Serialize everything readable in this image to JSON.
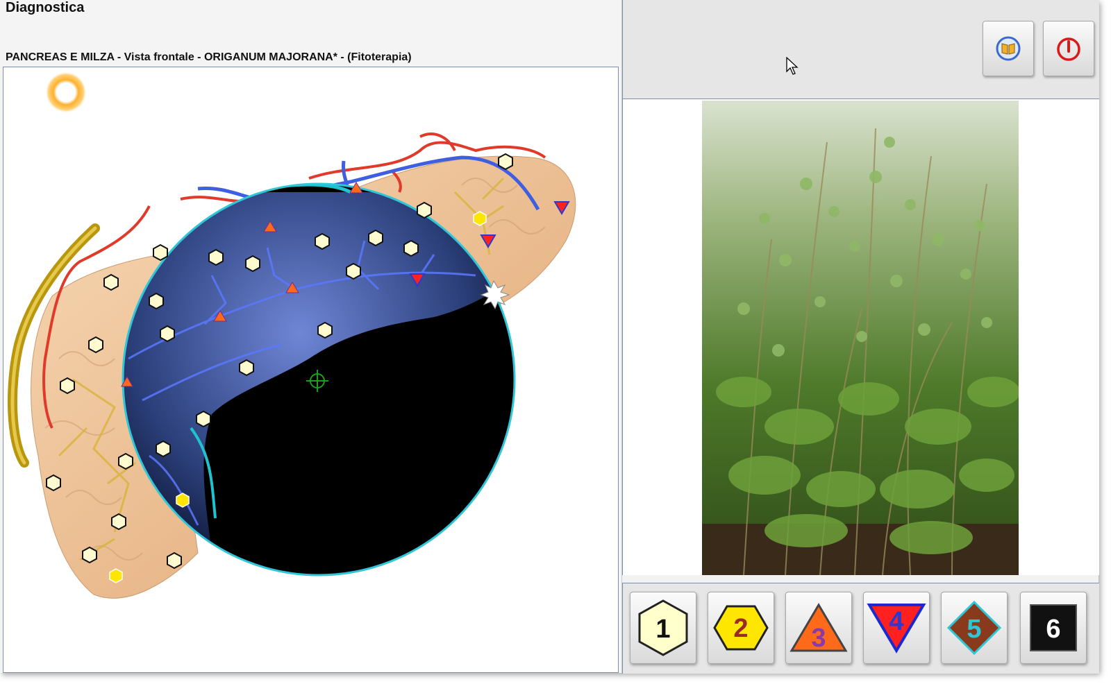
{
  "window": {
    "title": "Diagnostica",
    "caption": "PANCREAS E MILZA - Vista frontale - ORIGANUM  MAJORANA* - (Fitoterapia)"
  },
  "toolbar": {
    "buttons": [
      {
        "name": "book-button",
        "icon": "book-icon"
      },
      {
        "name": "power-button",
        "icon": "power-icon"
      }
    ]
  },
  "photo": {
    "subject": "origanum-majorana-plant-icon"
  },
  "marker_buttons": [
    {
      "label": "1",
      "shape": "hexagon-white",
      "fill": "#ffffcc"
    },
    {
      "label": "2",
      "shape": "hexagon-yellow",
      "fill": "#ffe600"
    },
    {
      "label": "3",
      "shape": "triangle-up-orange",
      "fill": "#ff6a1a"
    },
    {
      "label": "4",
      "shape": "triangle-down-red",
      "fill": "#ff2020"
    },
    {
      "label": "5",
      "shape": "diamond-brown",
      "fill": "#8a3a1c"
    },
    {
      "label": "6",
      "shape": "square-black",
      "fill": "#111111"
    }
  ],
  "colors": {
    "lens_border": "#2fc6d8",
    "lens_fill": "#000000",
    "organ": "#f1c9a0",
    "vein": "#3f5fe0",
    "artery": "#e03a2a",
    "duct": "#c9a822",
    "target": "#18a018"
  }
}
